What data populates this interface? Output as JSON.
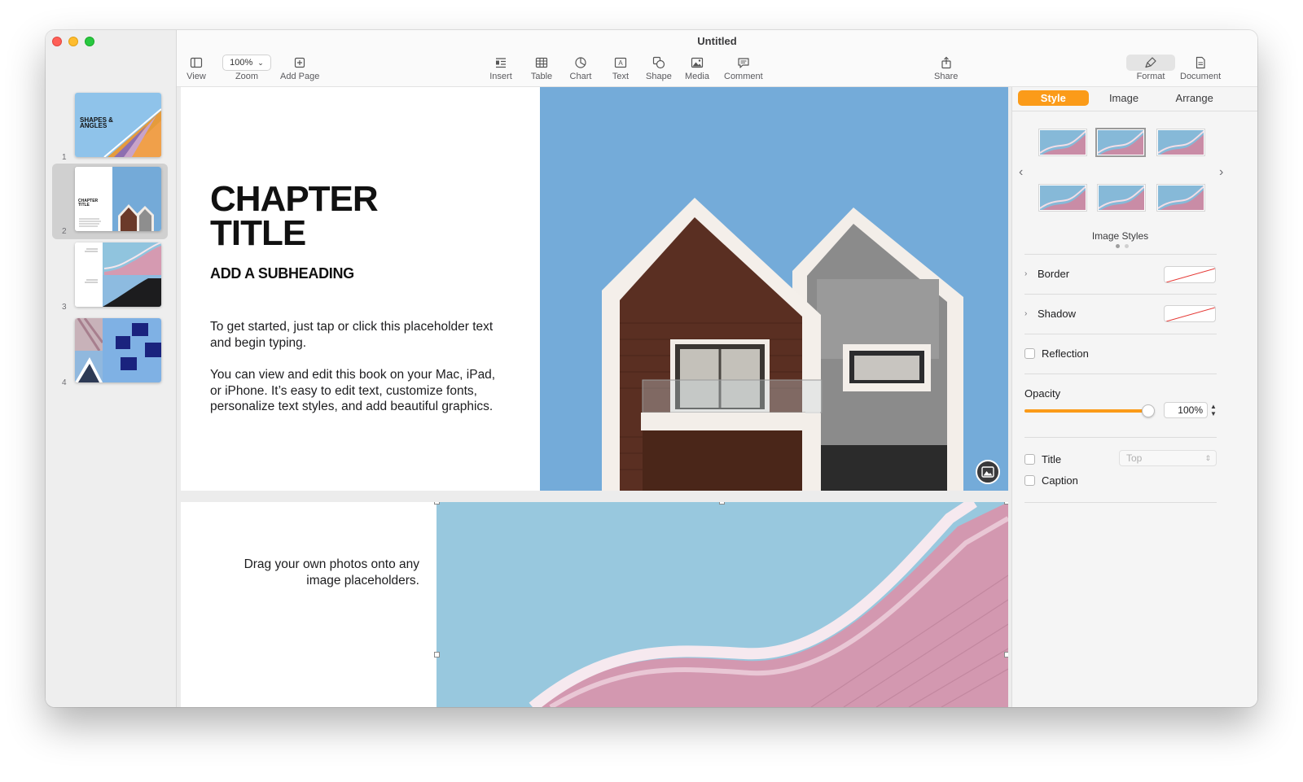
{
  "window": {
    "title": "Untitled"
  },
  "sidebar": {
    "pages": [
      {
        "number": "1",
        "cover_title": "SHAPES & ANGLES"
      },
      {
        "number": "2",
        "cover_title": "CHAPTER TITLE"
      },
      {
        "number": "3"
      },
      {
        "number": "4"
      }
    ]
  },
  "toolbar": {
    "view_label": "View",
    "zoom_value": "100%",
    "zoom_label": "Zoom",
    "add_page_label": "Add Page",
    "insert_label": "Insert",
    "table_label": "Table",
    "chart_label": "Chart",
    "text_label": "Text",
    "shape_label": "Shape",
    "media_label": "Media",
    "comment_label": "Comment",
    "share_label": "Share",
    "format_label": "Format",
    "document_label": "Document"
  },
  "page1": {
    "chapter_title": "CHAPTER\nTITLE",
    "subheading": "ADD A SUBHEADING",
    "paragraph1": "To get started, just tap or click this placeholder text and begin typing.",
    "paragraph2": "You can view and edit this book on your Mac, iPad, or iPhone. It’s easy to edit text, customize fonts, personalize text styles, and add beautiful graphics."
  },
  "page2": {
    "drag_text": "Drag your own photos onto any image placeholders."
  },
  "inspector": {
    "tabs": [
      "Style",
      "Image",
      "Arrange"
    ],
    "active_tab": "Style",
    "image_styles_label": "Image Styles",
    "border_label": "Border",
    "shadow_label": "Shadow",
    "reflection_label": "Reflection",
    "opacity_label": "Opacity",
    "opacity_value": "100%",
    "opacity_fraction": 1.0,
    "title_label": "Title",
    "title_position": "Top",
    "caption_label": "Caption"
  },
  "colors": {
    "accent": "#fb9b19",
    "sky_blue": "#78addb",
    "roof_pink": "#cd8fa6"
  }
}
